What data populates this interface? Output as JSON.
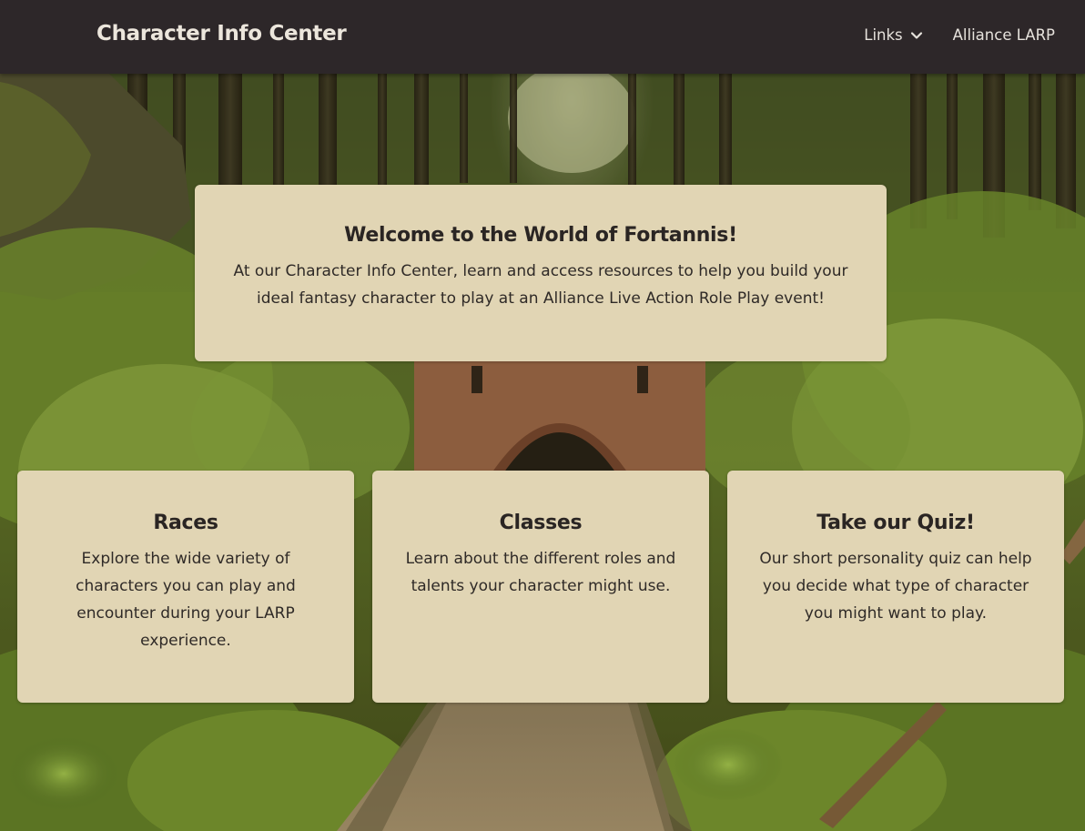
{
  "navbar": {
    "brand": "Character Info Center",
    "links_label": "Links",
    "alliance_label": "Alliance LARP"
  },
  "welcome": {
    "title": "Welcome to the World of Fortannis!",
    "text": "At our Character Info Center, learn and access resources to help you build your ideal fantasy character to play at an Alliance Live Action Role Play event!"
  },
  "cards": [
    {
      "title": "Races",
      "text": "Explore the wide variety of characters you can play and encounter during your LARP experience."
    },
    {
      "title": "Classes",
      "text": "Learn about the different roles and talents your character might use."
    },
    {
      "title": "Take our Quiz!",
      "text": "Our short personality quiz can help you decide what type of character you might want to play."
    }
  ],
  "icons": {
    "links_dropdown": "chevron-down-icon"
  },
  "colors": {
    "navbar_bg": "#2d2729",
    "card_bg": "#e1d5b4",
    "text": "#2a2523"
  }
}
